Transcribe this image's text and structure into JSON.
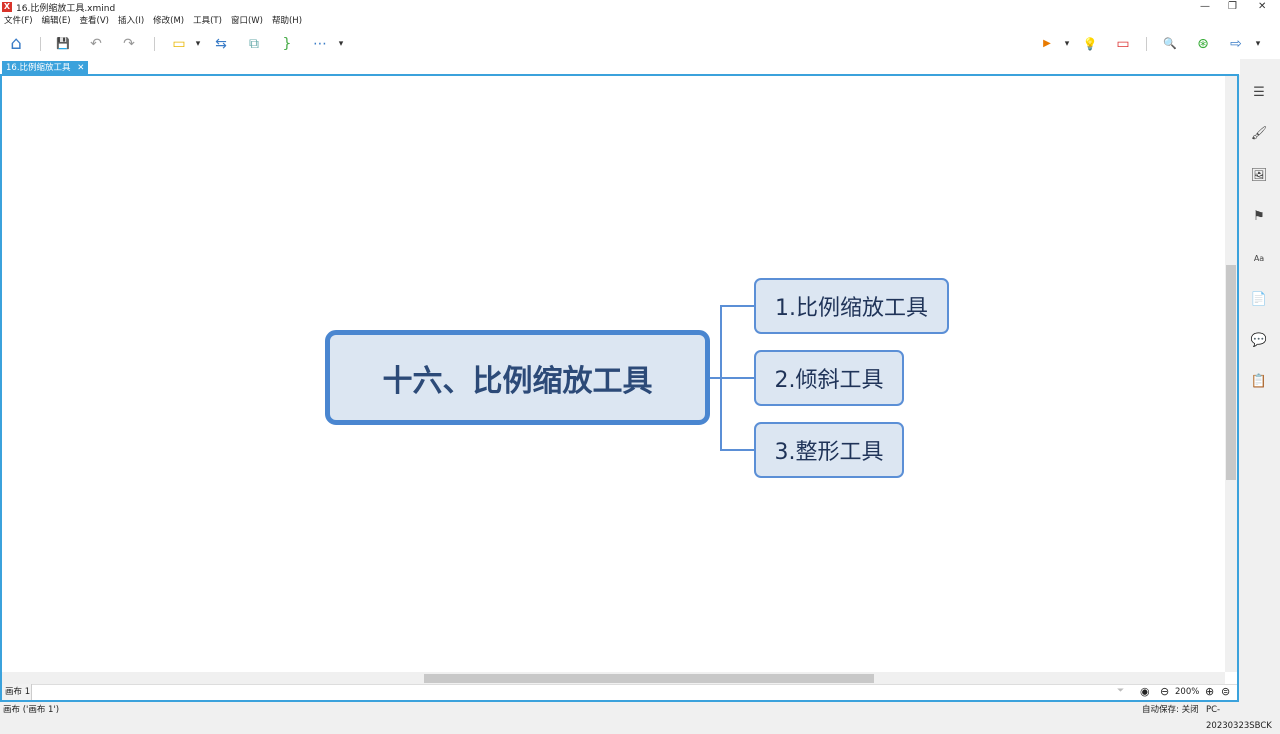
{
  "window": {
    "title": "16.比例缩放工具.xmind",
    "logo": "X",
    "min": "—",
    "max": "❐",
    "close": "✕"
  },
  "menu": [
    "文件(F)",
    "编辑(E)",
    "查看(V)",
    "插入(I)",
    "修改(M)",
    "工具(T)",
    "窗口(W)",
    "帮助(H)"
  ],
  "toolbar": {
    "home": "⌂",
    "save": "💾",
    "undo": "↶",
    "redo": "↷",
    "style": "▭",
    "dropdown": "▾",
    "relationship": "⇆",
    "summary": "⧉",
    "boundary": "}",
    "more": "⋯",
    "presentation": "▶",
    "idea": "💡",
    "outline": "▭",
    "search": "🔍",
    "share": "⊛",
    "export": "⇨"
  },
  "tab": {
    "label": "16.比例缩放工具",
    "close": "✕"
  },
  "mindmap": {
    "central": "十六、比例缩放工具",
    "subtopics": [
      "1.比例缩放工具",
      "2.倾斜工具",
      "3.整形工具"
    ]
  },
  "sheet": {
    "label": "画布 1"
  },
  "zoom": {
    "value": "200%",
    "minus": "⊖",
    "plus": "⊕",
    "fit": "⊜",
    "eye": "◉",
    "filter": "⏷"
  },
  "status": {
    "left": "画布 ('画布 1')",
    "autosave": "自动保存: 关闭",
    "machine": "PC-20230323SBCK"
  },
  "rightpanel": [
    "☰",
    "🖌",
    "🖼",
    "⚑",
    "Aa",
    "📄",
    "💬",
    "📋"
  ]
}
